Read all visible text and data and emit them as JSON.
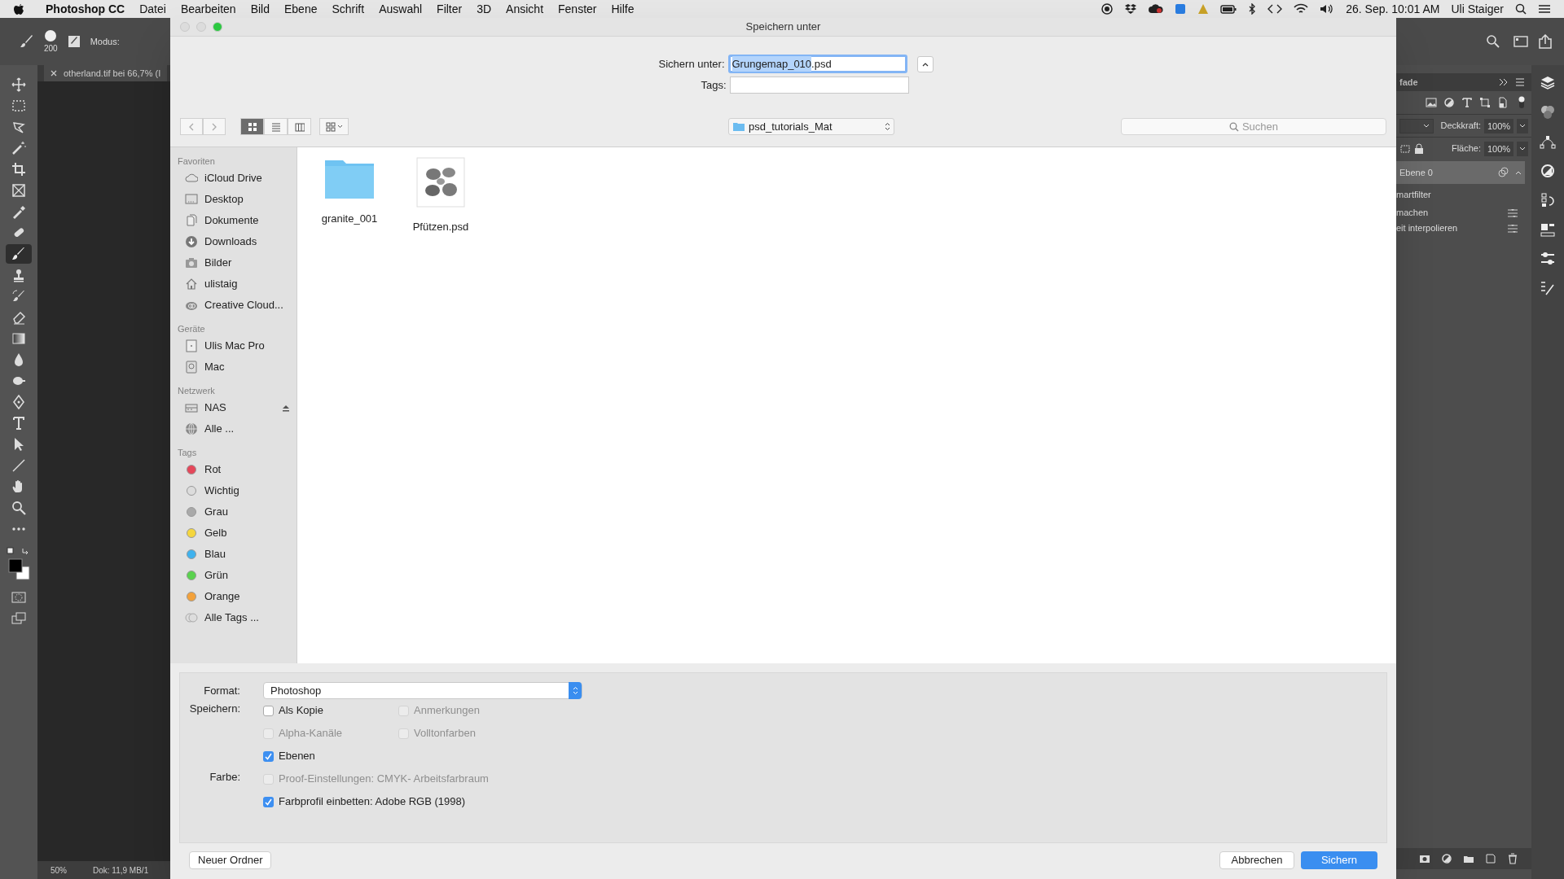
{
  "menu_bar": {
    "app_name": "Photoshop CC",
    "items": [
      "Datei",
      "Bearbeiten",
      "Bild",
      "Ebene",
      "Schrift",
      "Auswahl",
      "Filter",
      "3D",
      "Ansicht",
      "Fenster",
      "Hilfe"
    ],
    "clock": "26. Sep. 10:01 AM",
    "user": "Uli Staiger"
  },
  "options_bar": {
    "brush_size": "200",
    "mode_label": "Modus:"
  },
  "document_tab": {
    "title": "otherland.tif bei 66,7% (I"
  },
  "tools": [
    {
      "kind": "move",
      "selected": false
    },
    {
      "kind": "marquee",
      "selected": false
    },
    {
      "kind": "lasso",
      "selected": false
    },
    {
      "kind": "wand",
      "selected": false
    },
    {
      "kind": "crop",
      "selected": false
    },
    {
      "kind": "frame",
      "selected": false
    },
    {
      "kind": "eyedropper",
      "selected": false
    },
    {
      "kind": "healing",
      "selected": false
    },
    {
      "kind": "brush",
      "selected": true
    },
    {
      "kind": "stamp",
      "selected": false
    },
    {
      "kind": "history",
      "selected": false
    },
    {
      "kind": "eraser",
      "selected": false
    },
    {
      "kind": "gradient",
      "selected": false
    },
    {
      "kind": "blur",
      "selected": false
    },
    {
      "kind": "dodge",
      "selected": false
    },
    {
      "kind": "pen",
      "selected": false
    },
    {
      "kind": "type",
      "selected": false
    },
    {
      "kind": "select",
      "selected": false
    },
    {
      "kind": "line",
      "selected": false
    },
    {
      "kind": "hand",
      "selected": false
    },
    {
      "kind": "zoom",
      "selected": false
    },
    {
      "kind": "more",
      "selected": false
    }
  ],
  "status_bar": {
    "zoom": "50%",
    "document_info": "Dok: 11,9 MB/1"
  },
  "layers_panel": {
    "tab": "fade",
    "opacity_label": "Deckkraft:",
    "opacity": "100%",
    "fill_label": "Fläche:",
    "fill": "100%",
    "layers": [
      {
        "name": "Ebene 0",
        "kind": "layer",
        "selected": true
      },
      {
        "name": "martfilter",
        "kind": "heading",
        "selected": false
      },
      {
        "name": "machen",
        "kind": "filter",
        "selected": false
      },
      {
        "name": "eit interpolieren",
        "kind": "filter",
        "selected": false
      }
    ]
  },
  "dialog": {
    "title": "Speichern unter",
    "save_as_label": "Sichern unter:",
    "file_name_selected": "Grungemap_010",
    "file_name_rest": ".psd",
    "tags_label": "Tags:",
    "views": [
      {
        "kind": "icons",
        "selected": true
      },
      {
        "kind": "list",
        "selected": false
      },
      {
        "kind": "columns",
        "selected": false
      },
      {
        "kind": "gallery",
        "selected": false
      }
    ],
    "location": "psd_tutorials_Mat",
    "search_placeholder": "Suchen",
    "sidebar": [
      {
        "heading": "Favoriten",
        "items": [
          {
            "label": "iCloud Drive",
            "kind": "cloud"
          },
          {
            "label": "Desktop",
            "kind": "desktop"
          },
          {
            "label": "Dokumente",
            "kind": "documents"
          },
          {
            "label": "Downloads",
            "kind": "download"
          },
          {
            "label": "Bilder",
            "kind": "camera"
          },
          {
            "label": "ulistaig",
            "kind": "home"
          },
          {
            "label": "Creative Cloud...",
            "kind": "creative"
          }
        ]
      },
      {
        "heading": "Geräte",
        "items": [
          {
            "label": "Ulis Mac Pro",
            "kind": "computer"
          },
          {
            "label": "Mac",
            "kind": "drive"
          }
        ]
      },
      {
        "heading": "Netzwerk",
        "items": [
          {
            "label": "NAS",
            "kind": "nas",
            "ejectable": true
          },
          {
            "label": "Alle ...",
            "kind": "globe"
          }
        ]
      },
      {
        "heading": "Tags",
        "items": [
          {
            "label": "Rot",
            "kind": "tag",
            "color": "#e5475a"
          },
          {
            "label": "Wichtig",
            "kind": "tag",
            "color": "#dcdcdc"
          },
          {
            "label": "Grau",
            "kind": "tag",
            "color": "#a9a9a9"
          },
          {
            "label": "Gelb",
            "kind": "tag",
            "color": "#f5d63d"
          },
          {
            "label": "Blau",
            "kind": "tag",
            "color": "#3fb2ee"
          },
          {
            "label": "Grün",
            "kind": "tag",
            "color": "#5ad24e"
          },
          {
            "label": "Orange",
            "kind": "tag",
            "color": "#f3a13a"
          },
          {
            "label": "Alle Tags ...",
            "kind": "alltags"
          }
        ]
      }
    ],
    "files": [
      {
        "name": "granite_001",
        "kind": "folder"
      },
      {
        "name": "Pfützen.psd",
        "kind": "document"
      }
    ],
    "format_label": "Format:",
    "format": "Photoshop",
    "option_groups": [
      {
        "label": "Speichern:",
        "rows": [
          [
            {
              "label": "Als Kopie",
              "checked": false,
              "disabled": false
            },
            {
              "label": "Anmerkungen",
              "checked": false,
              "disabled": true
            }
          ],
          [
            {
              "label": "Alpha-Kanäle",
              "checked": false,
              "disabled": true
            },
            {
              "label": "Volltonfarben",
              "checked": false,
              "disabled": true
            }
          ],
          [
            {
              "label": "Ebenen",
              "checked": true,
              "disabled": false
            }
          ]
        ]
      },
      {
        "label": "Farbe:",
        "rows": [
          [
            {
              "label": "Proof-Einstellungen: CMYK- Arbeitsfarbraum",
              "checked": false,
              "disabled": true
            }
          ],
          [
            {
              "label": "Farbprofil einbetten: Adobe RGB (1998)",
              "checked": true,
              "disabled": false
            }
          ]
        ]
      }
    ],
    "new_folder": "Neuer Ordner",
    "cancel": "Abbrechen",
    "save": "Sichern"
  }
}
